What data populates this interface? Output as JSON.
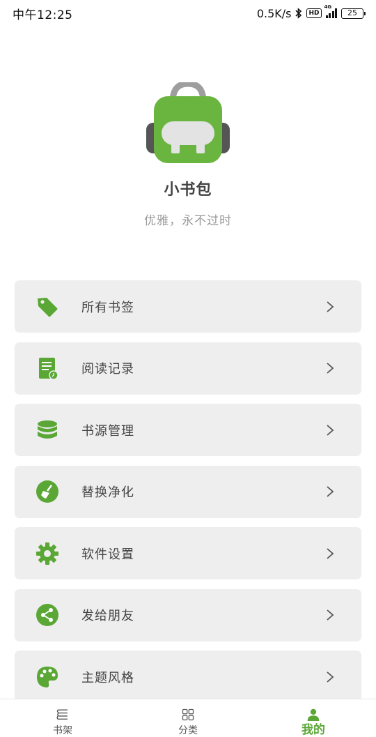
{
  "status_bar": {
    "time": "中午12:25",
    "net_speed": "0.5K/s",
    "hd": "HD",
    "network": "4G",
    "battery": "25"
  },
  "header": {
    "app_name": "小书包",
    "slogan": "优雅，永不过时"
  },
  "menu": {
    "items": [
      {
        "label": "所有书签",
        "icon": "bookmark-tag-icon"
      },
      {
        "label": "阅读记录",
        "icon": "reading-history-icon"
      },
      {
        "label": "书源管理",
        "icon": "database-icon"
      },
      {
        "label": "替换净化",
        "icon": "broom-icon"
      },
      {
        "label": "软件设置",
        "icon": "gear-icon"
      },
      {
        "label": "发给朋友",
        "icon": "share-icon"
      },
      {
        "label": "主题风格",
        "icon": "palette-icon"
      }
    ]
  },
  "bottom_nav": {
    "tabs": [
      {
        "label": "书架",
        "icon": "bookshelf-icon"
      },
      {
        "label": "分类",
        "icon": "grid-icon"
      },
      {
        "label": "我的",
        "icon": "person-icon",
        "active": true
      }
    ]
  },
  "colors": {
    "accent": "#5aa736",
    "card_bg": "#eeeeee",
    "text": "#444444",
    "subtle": "#999999"
  }
}
